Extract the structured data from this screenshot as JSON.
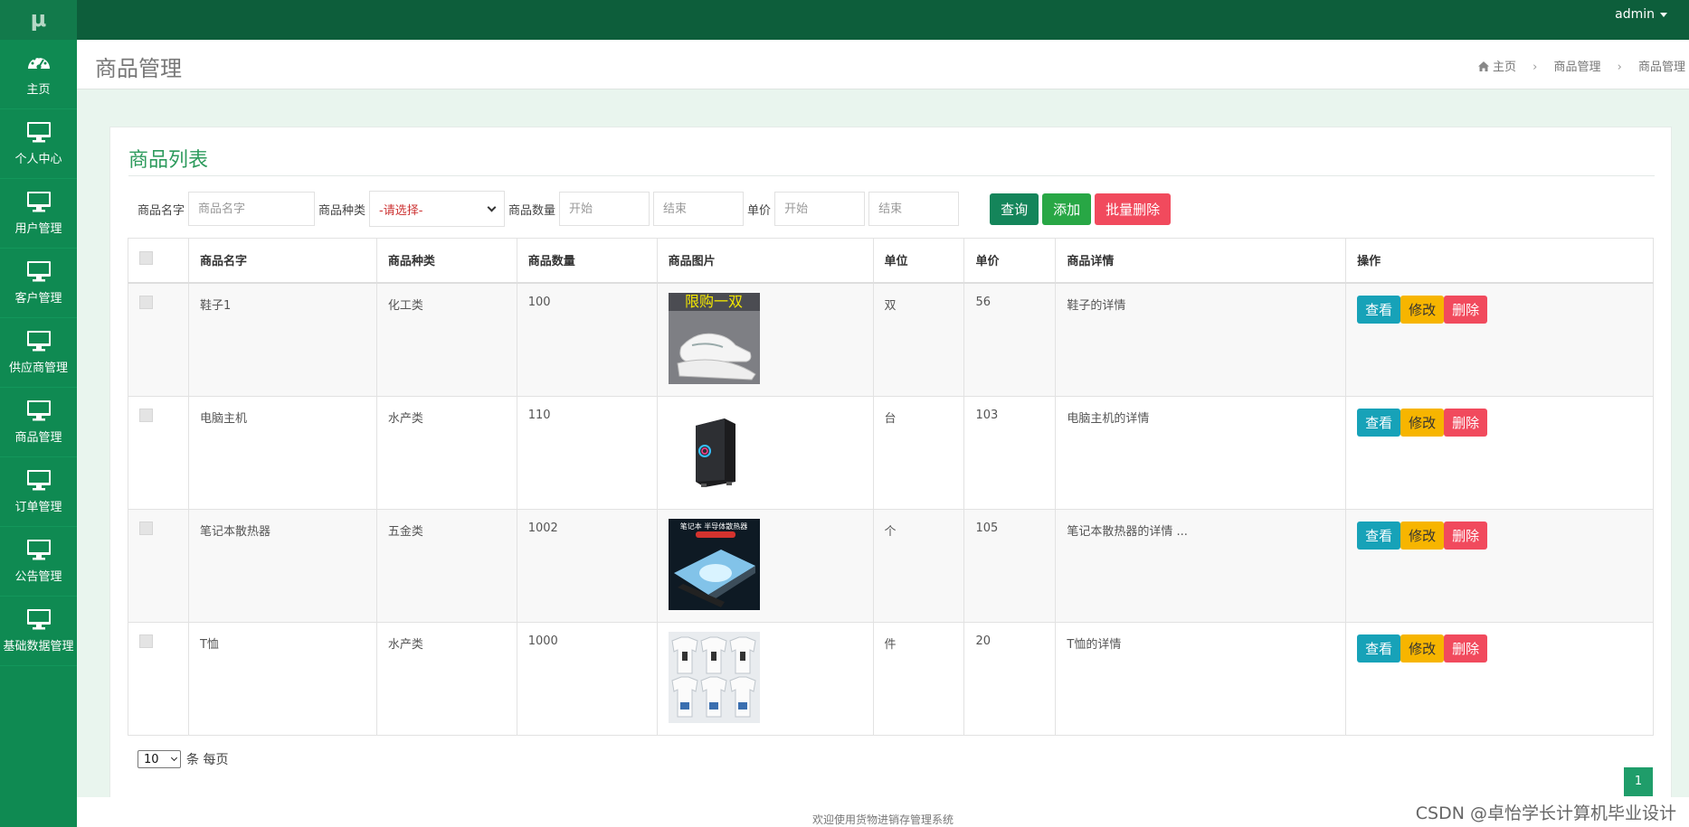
{
  "app": {
    "logo": "μ",
    "user": "admin"
  },
  "sidebar": {
    "items": [
      {
        "label": "主页",
        "icon": "dashboard-icon"
      },
      {
        "label": "个人中心",
        "icon": "monitor-icon"
      },
      {
        "label": "用户管理",
        "icon": "monitor-icon"
      },
      {
        "label": "客户管理",
        "icon": "monitor-icon"
      },
      {
        "label": "供应商管理",
        "icon": "monitor-icon"
      },
      {
        "label": "商品管理",
        "icon": "monitor-icon"
      },
      {
        "label": "订单管理",
        "icon": "monitor-icon"
      },
      {
        "label": "公告管理",
        "icon": "monitor-icon"
      },
      {
        "label": "基础数据管理",
        "icon": "monitor-icon"
      }
    ]
  },
  "header": {
    "title": "商品管理",
    "breadcrumb": [
      "主页",
      "商品管理",
      "商品管理"
    ]
  },
  "card": {
    "title": "商品列表"
  },
  "search": {
    "name_label": "商品名字",
    "name_placeholder": "商品名字",
    "type_label": "商品种类",
    "type_selected": "-请选择-",
    "qty_label": "商品数量",
    "qty_start_placeholder": "开始",
    "qty_end_placeholder": "结束",
    "price_label": "单价",
    "price_start_placeholder": "开始",
    "price_end_placeholder": "结束",
    "query_button": "查询",
    "add_button": "添加",
    "bulk_delete_button": "批量删除"
  },
  "table": {
    "columns": [
      "商品名字",
      "商品种类",
      "商品数量",
      "商品图片",
      "单位",
      "单价",
      "商品详情",
      "操作"
    ],
    "rows": [
      {
        "name": "鞋子1",
        "type": "化工类",
        "qty": "100",
        "image": "shoe-image",
        "image_text": "限购一双",
        "unit": "双",
        "price": "56",
        "detail": "鞋子的详情"
      },
      {
        "name": "电脑主机",
        "type": "水产类",
        "qty": "110",
        "image": "computer-case-image",
        "unit": "台",
        "price": "103",
        "detail": "电脑主机的详情"
      },
      {
        "name": "笔记本散热器",
        "type": "五金类",
        "qty": "1002",
        "image": "cooling-pad-image",
        "image_text": "笔记本 半导体散热器",
        "unit": "个",
        "price": "105",
        "detail": "笔记本散热器的详情 ..."
      },
      {
        "name": "T恤",
        "type": "水产类",
        "qty": "1000",
        "image": "tshirt-image",
        "unit": "件",
        "price": "20",
        "detail": "T恤的详情"
      }
    ],
    "actions": {
      "view": "查看",
      "edit": "修改",
      "delete": "删除"
    }
  },
  "pagination": {
    "page_size": "10",
    "per_page_text": "条 每页",
    "current_page": "1"
  },
  "footer": {
    "text": "欢迎使用货物进销存管理系统"
  },
  "watermark": "CSDN @卓怡学长计算机毕业设计",
  "colors": {
    "topbar": "#0d5e3b",
    "sidebar": "#0f8a52",
    "accent": "#2e9b5d",
    "danger": "#f14a5d",
    "warning": "#f7b500",
    "info": "#17a2b8"
  }
}
